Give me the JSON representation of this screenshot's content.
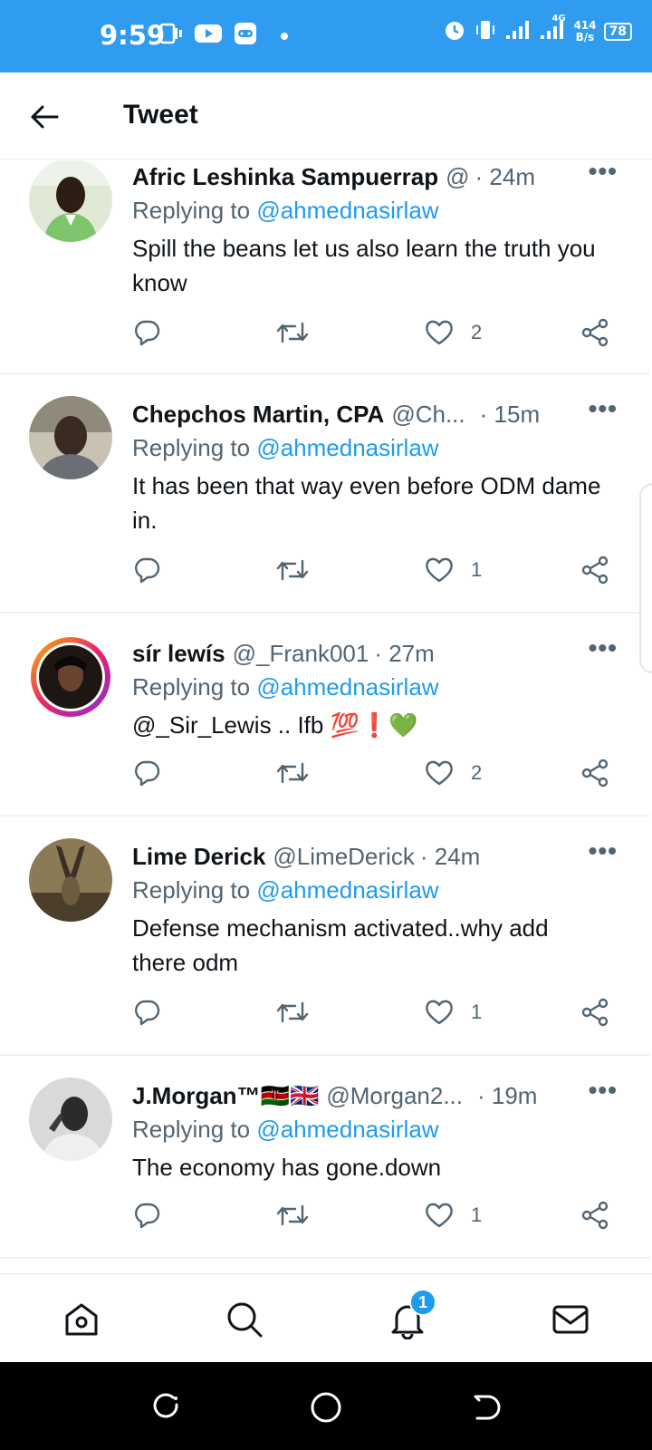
{
  "status_bar": {
    "time": "9:59",
    "network_type": "4G",
    "speed_value": "414",
    "speed_unit": "B/s",
    "battery": "78"
  },
  "header": {
    "title": "Tweet"
  },
  "tweets": [
    {
      "name": "Afric Leshinka Sampuerrap",
      "handle": "@",
      "time": "· 24m",
      "replying_prefix": "Replying to ",
      "replying_to": "@ahmednasirlaw",
      "text": "Spill the beans let us also learn the truth you know",
      "likes": "2"
    },
    {
      "name": "Chepchos Martin, CPA",
      "handle": "@Ch...",
      "time": "· 15m",
      "replying_prefix": "Replying to ",
      "replying_to": "@ahmednasirlaw",
      "text": "It has been that way even before ODM dame in.",
      "likes": "1"
    },
    {
      "name": "sír lewís",
      "handle": "@_Frank001",
      "time": "· 27m",
      "replying_prefix": "Replying to ",
      "replying_to": "@ahmednasirlaw",
      "text": "@_Sir_Lewis .. Ifb 💯❗💚",
      "likes": "2"
    },
    {
      "name": "Lime Derick",
      "handle": "@LimeDerick",
      "time": "· 24m",
      "replying_prefix": "Replying to ",
      "replying_to": "@ahmednasirlaw",
      "text": "Defense mechanism activated..why add there odm",
      "likes": "1"
    },
    {
      "name": "J.Morgan™🇰🇪🇬🇧",
      "handle": "@Morgan2...",
      "time": "· 19m",
      "replying_prefix": "Replying to ",
      "replying_to": "@ahmednasirlaw",
      "text": "The economy has gone.down",
      "likes": "1"
    }
  ],
  "more_label": "•••",
  "bottom_nav": {
    "notifications_badge": "1"
  },
  "icons": {
    "back": "arrow-left-icon",
    "reply": "reply-icon",
    "retweet": "retweet-icon",
    "like": "heart-icon",
    "share": "share-icon",
    "home": "home-icon",
    "search": "search-icon",
    "notifications": "bell-icon",
    "messages": "mail-icon"
  },
  "colors": {
    "status_bar": "#2f9cf0",
    "accent": "#1d9bf0",
    "secondary_text": "#536471"
  }
}
